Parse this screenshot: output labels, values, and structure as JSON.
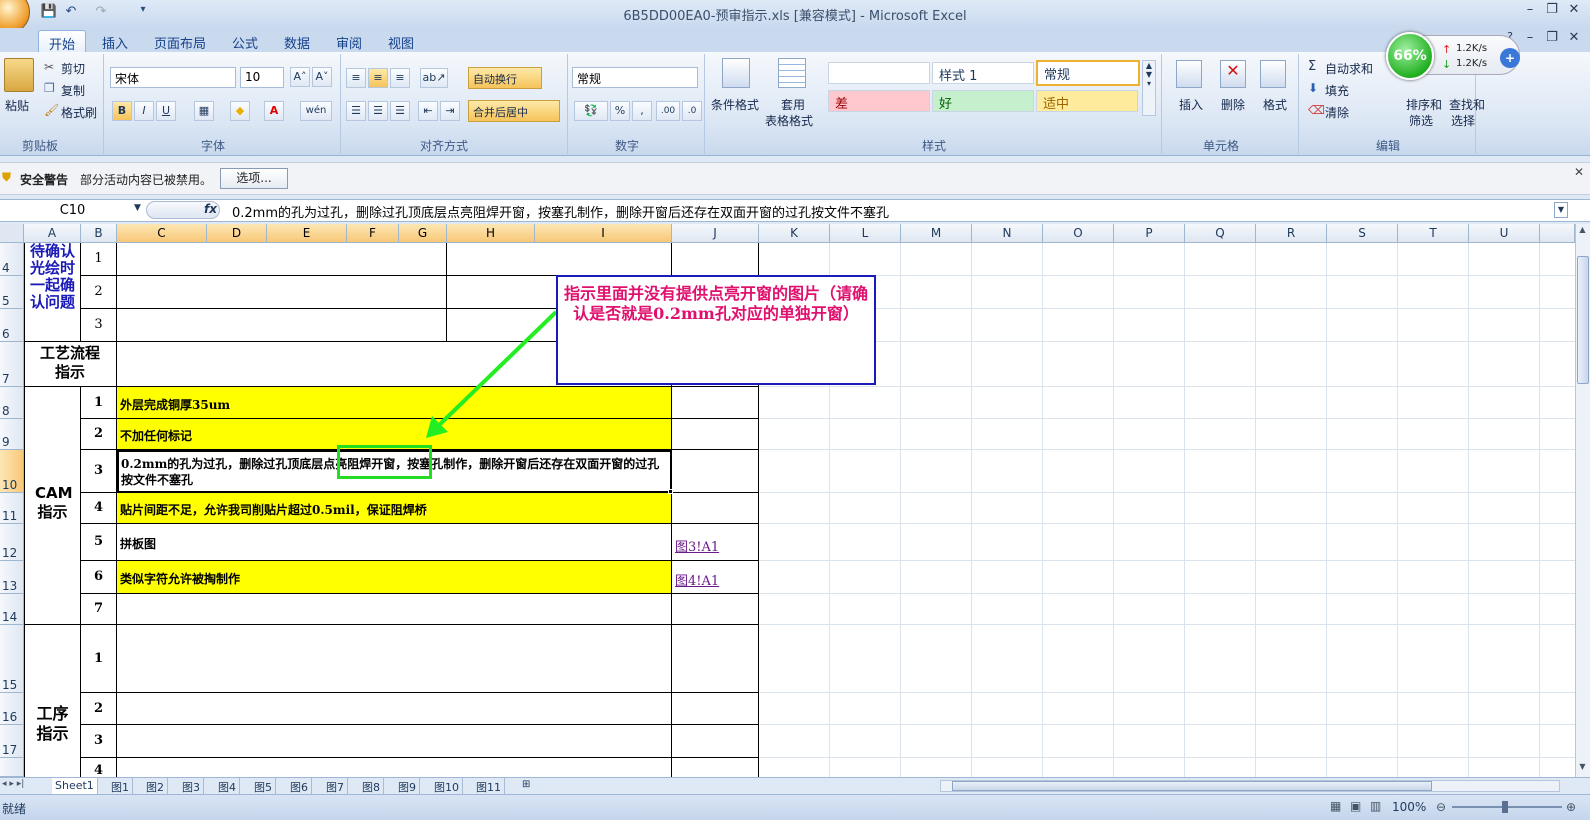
{
  "window": {
    "title": "6B5DD00EA0-预审指示.xls  [兼容模式] - Microsoft Excel"
  },
  "tabs": [
    "开始",
    "插入",
    "页面布局",
    "公式",
    "数据",
    "审阅",
    "视图"
  ],
  "ribbon": {
    "clipboard": {
      "paste": "粘贴",
      "cut": "剪切",
      "copy": "复制",
      "format_painter": "格式刷",
      "label": "剪贴板"
    },
    "font": {
      "name": "宋体",
      "size": "10",
      "label": "字体",
      "bold": "B",
      "italic": "I",
      "underline": "U",
      "grow": "A˄",
      "shrink": "A˅",
      "phonetic": "wén"
    },
    "alignment": {
      "wrap": "自动换行",
      "merge": "合并后居中",
      "label": "对齐方式"
    },
    "number": {
      "format": "常规",
      "percent": "%",
      "comma": ",",
      "label": "数字"
    },
    "styles": {
      "conditional": "条件格式",
      "table": "套用",
      "table2": "表格格式",
      "blank": "",
      "style1": "样式 1",
      "normal": "常规",
      "bad": "差",
      "good": "好",
      "neutral": "适中",
      "label": "样式",
      "colors": {
        "bad": "#ffc7ce",
        "good": "#c6efce",
        "neutral": "#ffeb9c"
      }
    },
    "cells": {
      "insert": "插入",
      "delete": "删除",
      "format": "格式",
      "label": "单元格"
    },
    "editing": {
      "autosum": "自动求和",
      "fill": "填充",
      "clear": "清除",
      "sort": "排序和",
      "sort2": "筛选",
      "find": "查找和",
      "find2": "选择",
      "label": "编辑"
    }
  },
  "network": {
    "percent": "66%",
    "up": "1.2K/s",
    "down": "1.2K/s"
  },
  "security": {
    "title": "安全警告",
    "message": "部分活动内容已被禁用。",
    "button": "选项..."
  },
  "formula_bar": {
    "name_box": "C10",
    "fx": "fx",
    "content": "0.2mm的孔为过孔，删除过孔顶底层点亮阻焊开窗，按塞孔制作，删除开窗后还存在双面开窗的过孔按文件不塞孔"
  },
  "columns": [
    "A",
    "B",
    "C",
    "D",
    "E",
    "F",
    "G",
    "H",
    "I",
    "J",
    "K",
    "L",
    "M",
    "N",
    "O",
    "P",
    "Q",
    "R",
    "S",
    "T",
    "U"
  ],
  "rows": [
    "4",
    "5",
    "6",
    "7",
    "8",
    "9",
    "10",
    "11",
    "12",
    "13",
    "14",
    "15",
    "16",
    "17"
  ],
  "sheet": {
    "a4": "待确认光绘时一起确认问题",
    "a7": "工艺流程指示",
    "cam": "CAM指示",
    "process": "工序指示",
    "nums": [
      "1",
      "2",
      "3"
    ],
    "cam_nums": [
      "1",
      "2",
      "3",
      "4",
      "5",
      "6",
      "7"
    ],
    "proc_nums": [
      "1",
      "2",
      "3",
      "4"
    ],
    "c8": "外层完成铜厚35um",
    "c9": "不加任何标记",
    "c10": "0.2mm的孔为过孔，删除过孔顶底层点亮阻焊开窗，按塞孔制作，删除开窗后还存在双面开窗的过孔按文件不塞孔",
    "c11": "贴片间距不足，允许我司削贴片超过0.5mil，保证阻焊桥",
    "c12": "拼板图",
    "c13": "类似字符允许被掏制作",
    "j12": "图3!A1",
    "j13": "图4!A1"
  },
  "callout": "指示里面并没有提供点亮开窗的图片（请确认是否就是0.2mm孔对应的单独开窗）",
  "sheet_tabs": [
    "Sheet1",
    "图1",
    "图2",
    "图3",
    "图4",
    "图5",
    "图6",
    "图7",
    "图8",
    "图9",
    "图10",
    "图11"
  ],
  "status": {
    "ready": "就绪",
    "zoom": "100%"
  }
}
